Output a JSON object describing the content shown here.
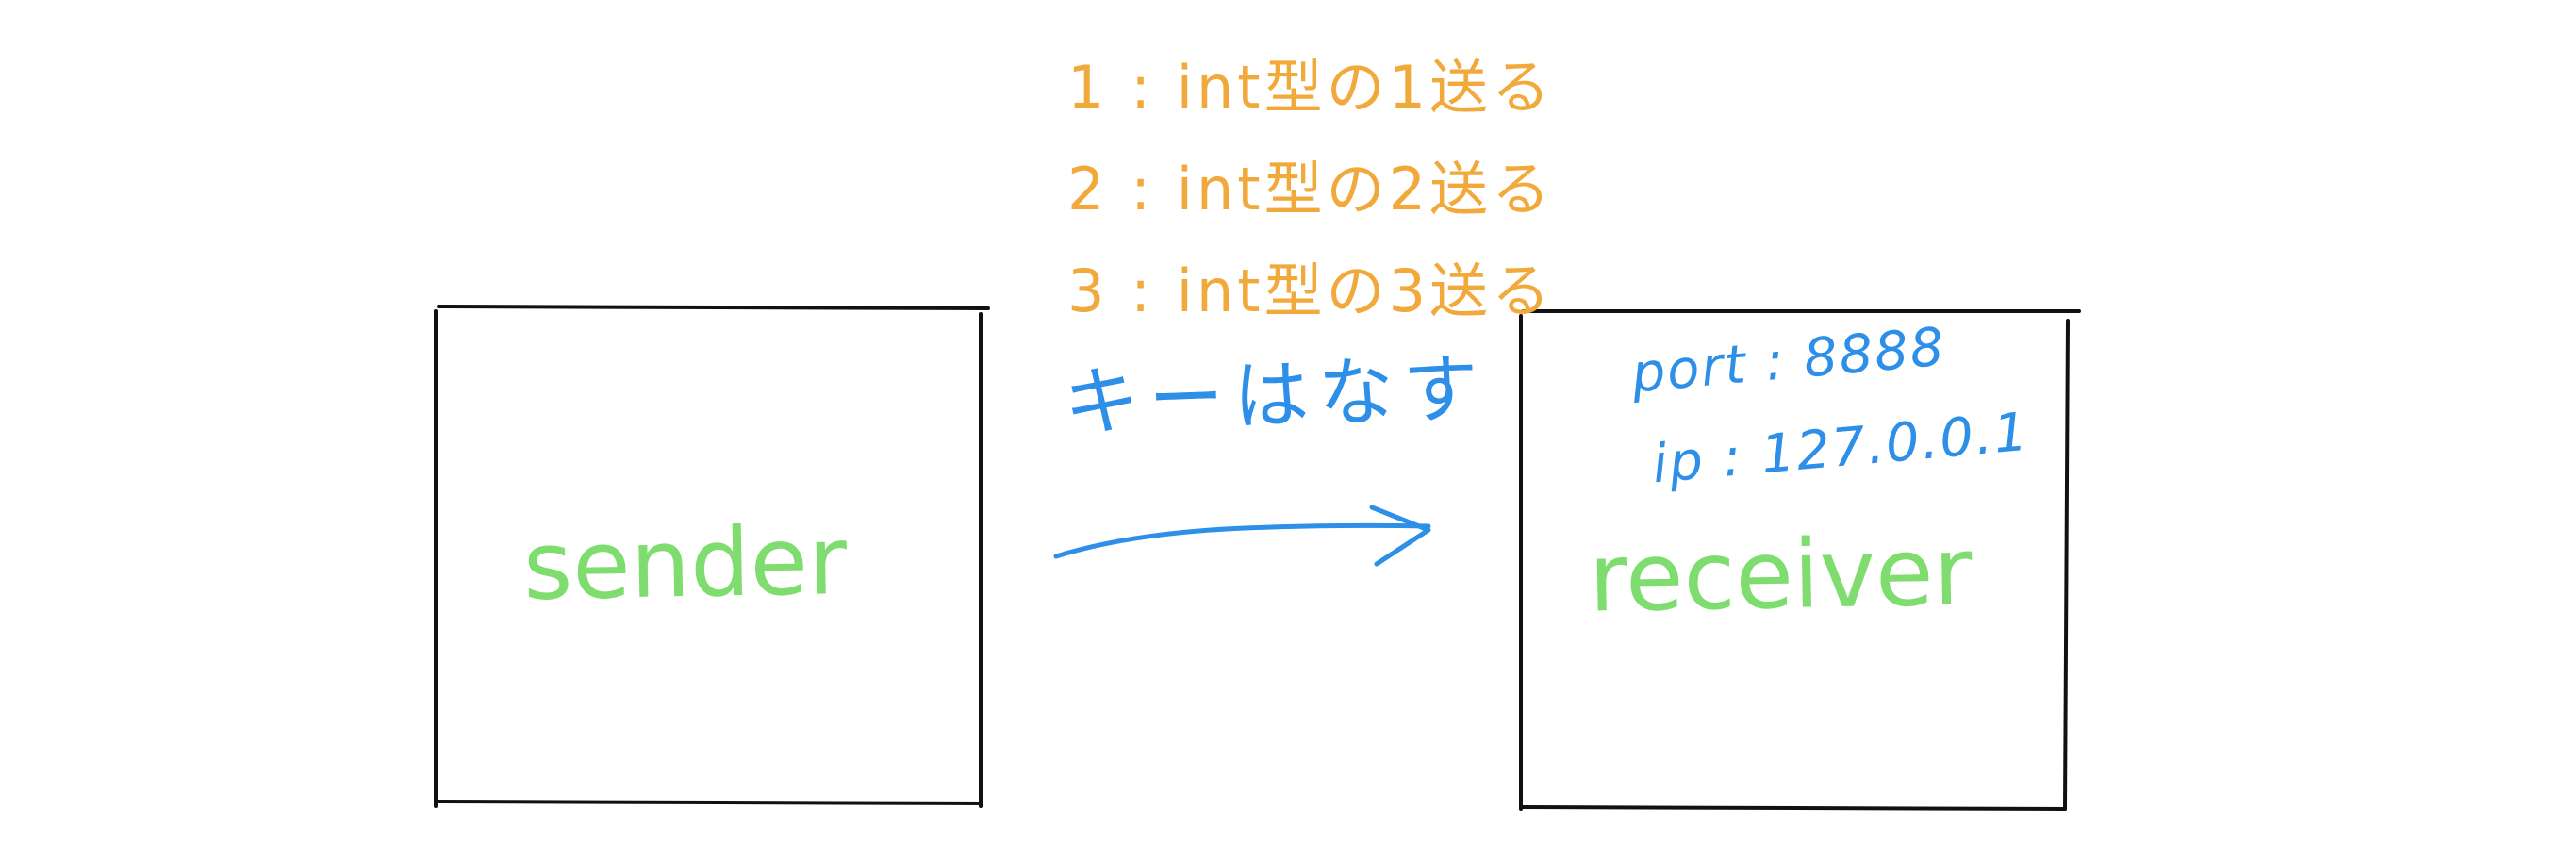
{
  "sender": {
    "label": "sender"
  },
  "receiver": {
    "label": "receiver",
    "port_line": "port : 8888",
    "ip_line": "ip : 127.0.0.1"
  },
  "steps": [
    "1 : int型の1送る",
    "2 : int型の2送る",
    "3 : int型の3送る"
  ],
  "release_key": "キーはなす",
  "colors": {
    "box_stroke": "#111111",
    "steps": "#f2a93b",
    "blue_annotation": "#2e8fe8",
    "labels": "#7fdc6e"
  }
}
